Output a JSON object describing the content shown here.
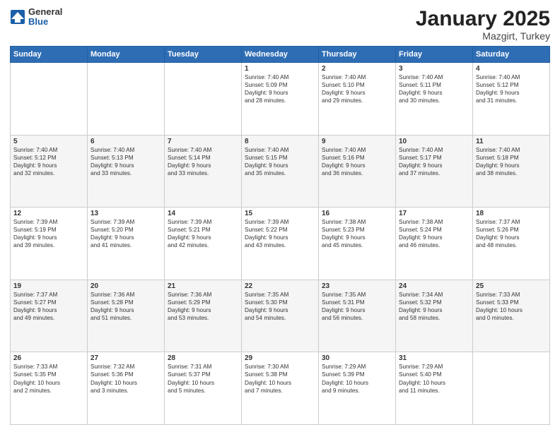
{
  "header": {
    "logo": {
      "general": "General",
      "blue": "Blue"
    },
    "title": "January 2025",
    "location": "Mazgirt, Turkey"
  },
  "days_of_week": [
    "Sunday",
    "Monday",
    "Tuesday",
    "Wednesday",
    "Thursday",
    "Friday",
    "Saturday"
  ],
  "weeks": [
    [
      {
        "day": "",
        "content": ""
      },
      {
        "day": "",
        "content": ""
      },
      {
        "day": "",
        "content": ""
      },
      {
        "day": "1",
        "content": "Sunrise: 7:40 AM\nSunset: 5:09 PM\nDaylight: 9 hours\nand 28 minutes."
      },
      {
        "day": "2",
        "content": "Sunrise: 7:40 AM\nSunset: 5:10 PM\nDaylight: 9 hours\nand 29 minutes."
      },
      {
        "day": "3",
        "content": "Sunrise: 7:40 AM\nSunset: 5:11 PM\nDaylight: 9 hours\nand 30 minutes."
      },
      {
        "day": "4",
        "content": "Sunrise: 7:40 AM\nSunset: 5:12 PM\nDaylight: 9 hours\nand 31 minutes."
      }
    ],
    [
      {
        "day": "5",
        "content": "Sunrise: 7:40 AM\nSunset: 5:12 PM\nDaylight: 9 hours\nand 32 minutes."
      },
      {
        "day": "6",
        "content": "Sunrise: 7:40 AM\nSunset: 5:13 PM\nDaylight: 9 hours\nand 33 minutes."
      },
      {
        "day": "7",
        "content": "Sunrise: 7:40 AM\nSunset: 5:14 PM\nDaylight: 9 hours\nand 33 minutes."
      },
      {
        "day": "8",
        "content": "Sunrise: 7:40 AM\nSunset: 5:15 PM\nDaylight: 9 hours\nand 35 minutes."
      },
      {
        "day": "9",
        "content": "Sunrise: 7:40 AM\nSunset: 5:16 PM\nDaylight: 9 hours\nand 36 minutes."
      },
      {
        "day": "10",
        "content": "Sunrise: 7:40 AM\nSunset: 5:17 PM\nDaylight: 9 hours\nand 37 minutes."
      },
      {
        "day": "11",
        "content": "Sunrise: 7:40 AM\nSunset: 5:18 PM\nDaylight: 9 hours\nand 38 minutes."
      }
    ],
    [
      {
        "day": "12",
        "content": "Sunrise: 7:39 AM\nSunset: 5:19 PM\nDaylight: 9 hours\nand 39 minutes."
      },
      {
        "day": "13",
        "content": "Sunrise: 7:39 AM\nSunset: 5:20 PM\nDaylight: 9 hours\nand 41 minutes."
      },
      {
        "day": "14",
        "content": "Sunrise: 7:39 AM\nSunset: 5:21 PM\nDaylight: 9 hours\nand 42 minutes."
      },
      {
        "day": "15",
        "content": "Sunrise: 7:39 AM\nSunset: 5:22 PM\nDaylight: 9 hours\nand 43 minutes."
      },
      {
        "day": "16",
        "content": "Sunrise: 7:38 AM\nSunset: 5:23 PM\nDaylight: 9 hours\nand 45 minutes."
      },
      {
        "day": "17",
        "content": "Sunrise: 7:38 AM\nSunset: 5:24 PM\nDaylight: 9 hours\nand 46 minutes."
      },
      {
        "day": "18",
        "content": "Sunrise: 7:37 AM\nSunset: 5:26 PM\nDaylight: 9 hours\nand 48 minutes."
      }
    ],
    [
      {
        "day": "19",
        "content": "Sunrise: 7:37 AM\nSunset: 5:27 PM\nDaylight: 9 hours\nand 49 minutes."
      },
      {
        "day": "20",
        "content": "Sunrise: 7:36 AM\nSunset: 5:28 PM\nDaylight: 9 hours\nand 51 minutes."
      },
      {
        "day": "21",
        "content": "Sunrise: 7:36 AM\nSunset: 5:29 PM\nDaylight: 9 hours\nand 53 minutes."
      },
      {
        "day": "22",
        "content": "Sunrise: 7:35 AM\nSunset: 5:30 PM\nDaylight: 9 hours\nand 54 minutes."
      },
      {
        "day": "23",
        "content": "Sunrise: 7:35 AM\nSunset: 5:31 PM\nDaylight: 9 hours\nand 56 minutes."
      },
      {
        "day": "24",
        "content": "Sunrise: 7:34 AM\nSunset: 5:32 PM\nDaylight: 9 hours\nand 58 minutes."
      },
      {
        "day": "25",
        "content": "Sunrise: 7:33 AM\nSunset: 5:33 PM\nDaylight: 10 hours\nand 0 minutes."
      }
    ],
    [
      {
        "day": "26",
        "content": "Sunrise: 7:33 AM\nSunset: 5:35 PM\nDaylight: 10 hours\nand 2 minutes."
      },
      {
        "day": "27",
        "content": "Sunrise: 7:32 AM\nSunset: 5:36 PM\nDaylight: 10 hours\nand 3 minutes."
      },
      {
        "day": "28",
        "content": "Sunrise: 7:31 AM\nSunset: 5:37 PM\nDaylight: 10 hours\nand 5 minutes."
      },
      {
        "day": "29",
        "content": "Sunrise: 7:30 AM\nSunset: 5:38 PM\nDaylight: 10 hours\nand 7 minutes."
      },
      {
        "day": "30",
        "content": "Sunrise: 7:29 AM\nSunset: 5:39 PM\nDaylight: 10 hours\nand 9 minutes."
      },
      {
        "day": "31",
        "content": "Sunrise: 7:29 AM\nSunset: 5:40 PM\nDaylight: 10 hours\nand 11 minutes."
      },
      {
        "day": "",
        "content": ""
      }
    ]
  ]
}
